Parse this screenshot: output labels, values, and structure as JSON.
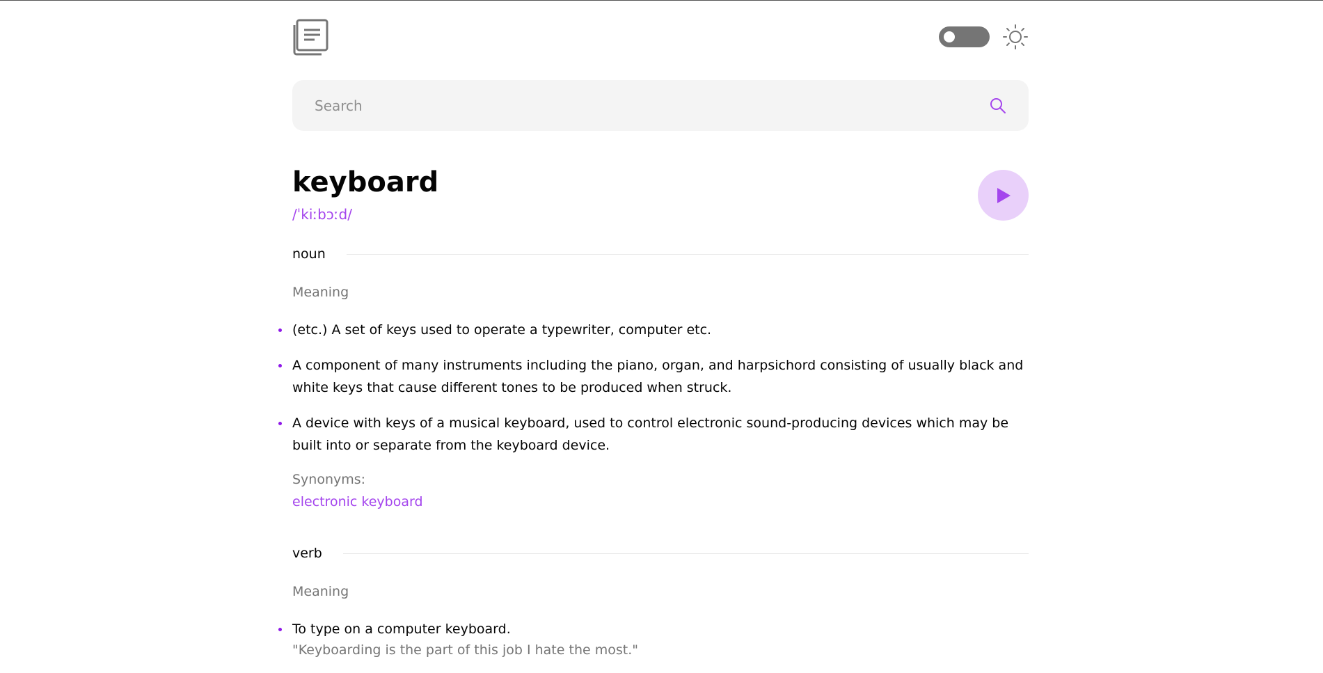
{
  "header": {
    "logo_icon": "book-icon",
    "theme_toggle_state": "off",
    "theme_icon": "sun-icon"
  },
  "search": {
    "placeholder": "Search",
    "value": "",
    "icon": "search-icon"
  },
  "entry": {
    "word": "keyboard",
    "phonetic": "/ˈkiːbɔːd/",
    "play_icon": "play-icon"
  },
  "meanings": [
    {
      "part_of_speech": "noun",
      "meaning_label": "Meaning",
      "definitions": [
        "(etc.) A set of keys used to operate a typewriter, computer etc.",
        "A component of many instruments including the piano, organ, and harpsichord consisting of usually black and white keys that cause different tones to be produced when struck.",
        "A device with keys of a musical keyboard, used to control electronic sound-producing devices which may be built into or separate from the keyboard device."
      ],
      "synonyms_label": "Synonyms:",
      "synonyms": [
        "electronic keyboard"
      ]
    },
    {
      "part_of_speech": "verb",
      "meaning_label": "Meaning",
      "definitions": [
        "To type on a computer keyboard."
      ],
      "example": "\"Keyboarding is the part of this job I hate the most.\""
    }
  ],
  "colors": {
    "accent": "#a445ed",
    "play_bg": "#e9d0fa",
    "search_bg": "#f4f4f4",
    "muted_text": "#757575"
  }
}
